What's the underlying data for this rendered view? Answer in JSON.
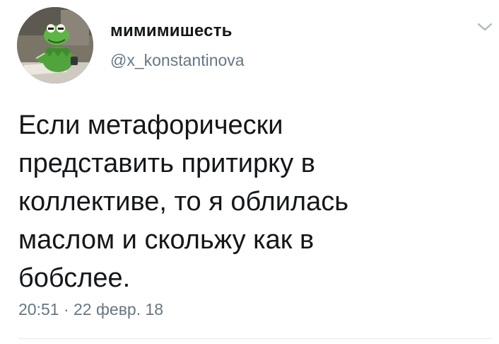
{
  "tweet": {
    "display_name": "мимимишесть",
    "handle": "@x_konstantinova",
    "text": "Если метафорически\nпредставить притирку в\nколлективе, то я облилась\nмаслом и скольжу как в\nбобслее.",
    "time": "20:51",
    "separator": "·",
    "date": "22 февр. 18",
    "menu_icon": "chevron-down-icon",
    "avatar_icon": "kermit-frog-avatar"
  },
  "colors": {
    "text": "#14171a",
    "secondary": "#657786",
    "divider": "#e1e8ed",
    "chevron": "#aab8c2"
  }
}
